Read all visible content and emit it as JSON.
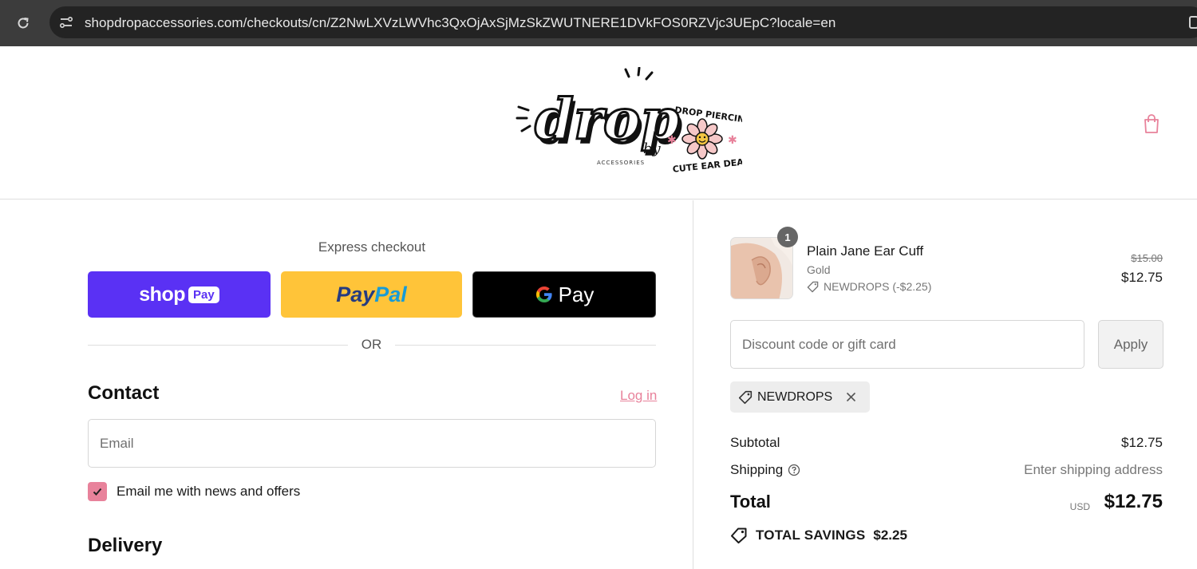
{
  "browser": {
    "url": "shopdropaccessories.com/checkouts/cn/Z2NwLXVzLWVhc3QxOjAxSjMzSkZWUTNERE1DVkFOS0RZVjc3UEpC?locale=en"
  },
  "header": {
    "logo": {
      "brand": "drop",
      "by": "by",
      "accessories": "ACCESSORIES",
      "badge_top": "DROP PIERCING",
      "badge_bottom": "CUTE EAR DEAR"
    }
  },
  "express": {
    "title": "Express checkout",
    "shop_pay": {
      "word": "shop",
      "badge": "Pay"
    },
    "paypal": {
      "part1": "Pay",
      "part2": "Pal"
    },
    "gpay": {
      "word": "Pay"
    },
    "or_label": "OR"
  },
  "contact": {
    "title": "Contact",
    "login_label": "Log in",
    "email_placeholder": "Email",
    "newsletter_label": "Email me with news and offers",
    "newsletter_checked": true
  },
  "delivery": {
    "title": "Delivery"
  },
  "summary": {
    "item": {
      "quantity": "1",
      "name": "Plain Jane Ear Cuff",
      "variant": "Gold",
      "discount": "NEWDROPS (-$2.25)",
      "original_price": "$15.00",
      "price": "$12.75"
    },
    "discount_placeholder": "Discount code or gift card",
    "apply_label": "Apply",
    "applied_code": "NEWDROPS",
    "subtotal_label": "Subtotal",
    "subtotal_value": "$12.75",
    "shipping_label": "Shipping",
    "shipping_value": "Enter shipping address",
    "total_label": "Total",
    "total_currency": "USD",
    "total_value": "$12.75",
    "savings_label": "TOTAL SAVINGS",
    "savings_value": "$2.25"
  },
  "colors": {
    "accent_pink": "#e8829b",
    "shop_pay": "#5a31f4",
    "paypal": "#ffc439",
    "gpay": "#000000"
  },
  "icons": [
    "reload-icon",
    "site-info-icon",
    "shopping-bag-icon",
    "google-g-icon",
    "checkmark-icon",
    "tag-icon",
    "close-icon",
    "question-circle-icon",
    "savings-tag-icon"
  ]
}
